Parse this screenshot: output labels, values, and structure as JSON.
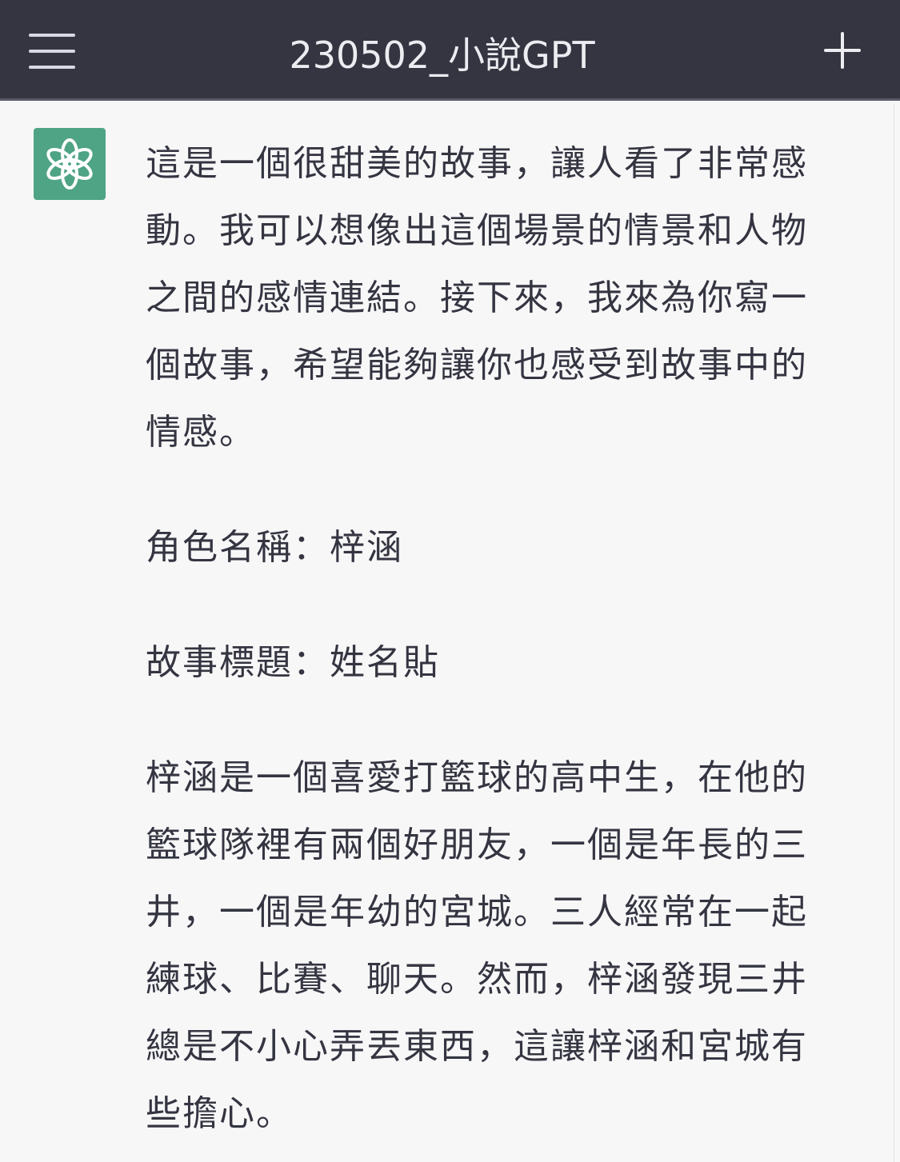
{
  "header": {
    "title": "230502_小說GPT",
    "menu_icon": "hamburger-menu-icon",
    "new_icon": "plus-icon"
  },
  "message": {
    "avatar_icon": "openai-logo-icon",
    "avatar_color": "#4fa485",
    "paragraphs": [
      "這是一個很甜美的故事，讓人看了非常感動。我可以想像出這個場景的情景和人物之間的感情連結。接下來，我來為你寫一個故事，希望能夠讓你也感受到故事中的情感。",
      "角色名稱：梓涵",
      "故事標題：姓名貼",
      "梓涵是一個喜愛打籃球的高中生，在他的籃球隊裡有兩個好朋友，一個是年長的三井，一個是年幼的宮城。三人經常在一起練球、比賽、聊天。然而，梓涵發現三井總是不小心弄丟東西，這讓梓涵和宮城有些擔心。"
    ]
  },
  "colors": {
    "header_bg": "#343541",
    "page_bg": "#f7f7f8",
    "text": "#343541"
  }
}
